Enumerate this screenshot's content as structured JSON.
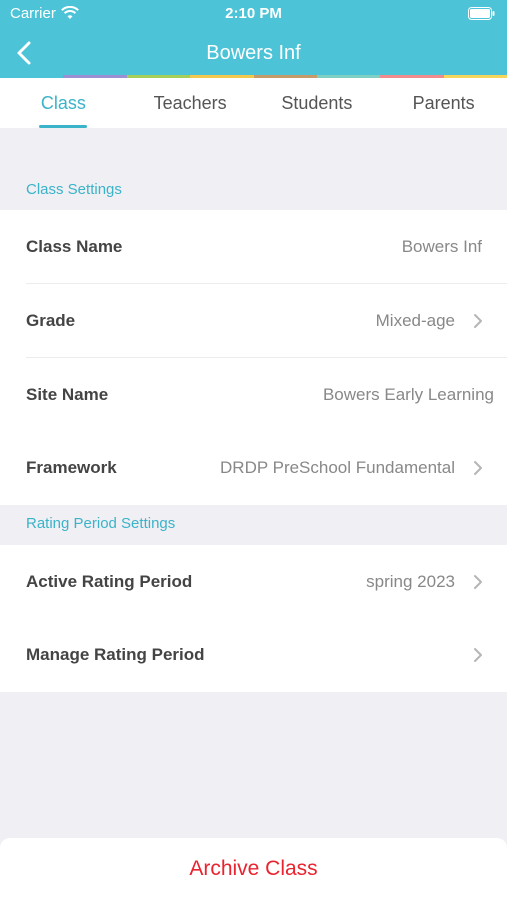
{
  "status": {
    "carrier": "Carrier",
    "time": "2:10 PM"
  },
  "nav": {
    "title": "Bowers Inf"
  },
  "colors": {
    "header": "#4cc3d6",
    "accent": "#3bb3c9",
    "danger": "#e9232f"
  },
  "tabs": [
    {
      "label": "Class"
    },
    {
      "label": "Teachers"
    },
    {
      "label": "Students"
    },
    {
      "label": "Parents"
    }
  ],
  "class_settings": {
    "header": "Class Settings",
    "rows": [
      {
        "label": "Class Name",
        "value": "Bowers Inf"
      },
      {
        "label": "Grade",
        "value": "Mixed-age"
      },
      {
        "label": "Site Name",
        "value": "Bowers Early Learning"
      },
      {
        "label": "Framework",
        "value": "DRDP PreSchool Fundamental"
      }
    ]
  },
  "rating_settings": {
    "header": "Rating Period Settings",
    "rows": [
      {
        "label": "Active Rating Period",
        "value": "spring 2023"
      },
      {
        "label": "Manage Rating Period",
        "value": ""
      }
    ]
  },
  "archive": {
    "label": "Archive Class"
  }
}
